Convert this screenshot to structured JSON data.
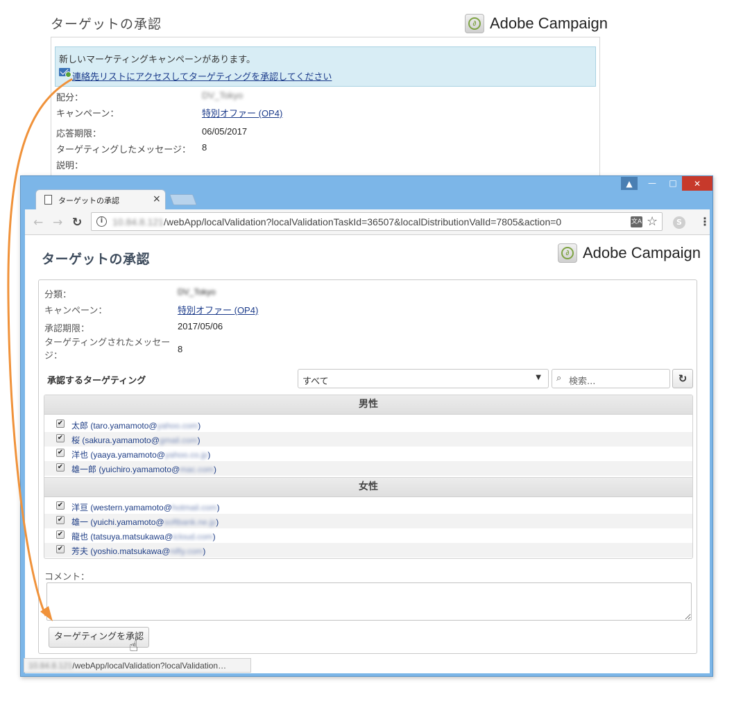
{
  "bg_email": {
    "title": "ターゲットの承認",
    "brand": "Adobe Campaign",
    "notice_line1": "新しいマーケティングキャンペーンがあります。",
    "notice_link": "連絡先リストにアクセスしてターゲティングを承認してください",
    "fields": [
      {
        "label": "配分：",
        "value": "DV_Tokyo"
      },
      {
        "label": "キャンペーン：",
        "value": "特別オファー (OP4)"
      },
      {
        "label": "応答期限：",
        "value": "06/05/2017"
      },
      {
        "label": "ターゲティングしたメッセージ：",
        "value": "8"
      },
      {
        "label": "説明：",
        "value": ""
      }
    ]
  },
  "browser": {
    "tab_title": "ターゲットの承認",
    "tab_close": "×",
    "url_host": "10.84.8.121",
    "url_path": "/webApp/localValidation?localValidationTaskId=36507&localDistributionValId=7805&action=0",
    "status_host": "10.84.8.121",
    "status_path": "/webApp/localValidation?localValidation…"
  },
  "page": {
    "title": "ターゲットの承認",
    "brand": "Adobe Campaign",
    "fields": [
      {
        "label": "分類：",
        "value": "DV_Tokyo"
      },
      {
        "label": "キャンペーン：",
        "value": "特別オファー (OP4)"
      },
      {
        "label": "承認期限：",
        "value": "2017/05/06"
      },
      {
        "label": "ターゲティングされたメッセージ：",
        "value": "8"
      }
    ],
    "targeting_heading": "承認するターゲティング",
    "filter_value": "すべて",
    "search_placeholder": "検索...",
    "groups": [
      {
        "name": "男性",
        "items": [
          {
            "name": "太郎",
            "user": "taro.yamamoto@",
            "domain": "yahoo.com"
          },
          {
            "name": "桜",
            "user": "sakura.yamamoto@",
            "domain": "gmail.com"
          },
          {
            "name": "洋也",
            "user": "yaaya.yamamoto@",
            "domain": "yahoo.co.jp"
          },
          {
            "name": "雄一郎",
            "user": "yuichiro.yamamoto@",
            "domain": "mac.com"
          }
        ]
      },
      {
        "name": "女性",
        "items": [
          {
            "name": "洋亘",
            "user": "western.yamamoto@",
            "domain": "hotmail.com"
          },
          {
            "name": "雄一",
            "user": "yuichi.yamamoto@",
            "domain": "softbank.ne.jp"
          },
          {
            "name": "龍也",
            "user": "tatsuya.matsukawa@",
            "domain": "icloud.com"
          },
          {
            "name": "芳夫",
            "user": "yoshio.matsukawa@",
            "domain": "nifty.com"
          }
        ]
      }
    ],
    "comment_label": "コメント：",
    "approve_button": "ターゲティングを承認"
  },
  "colors": {
    "accent_arrow": "#f0923a",
    "link": "#1a3a8a",
    "window_frame": "#7cb6e8"
  }
}
